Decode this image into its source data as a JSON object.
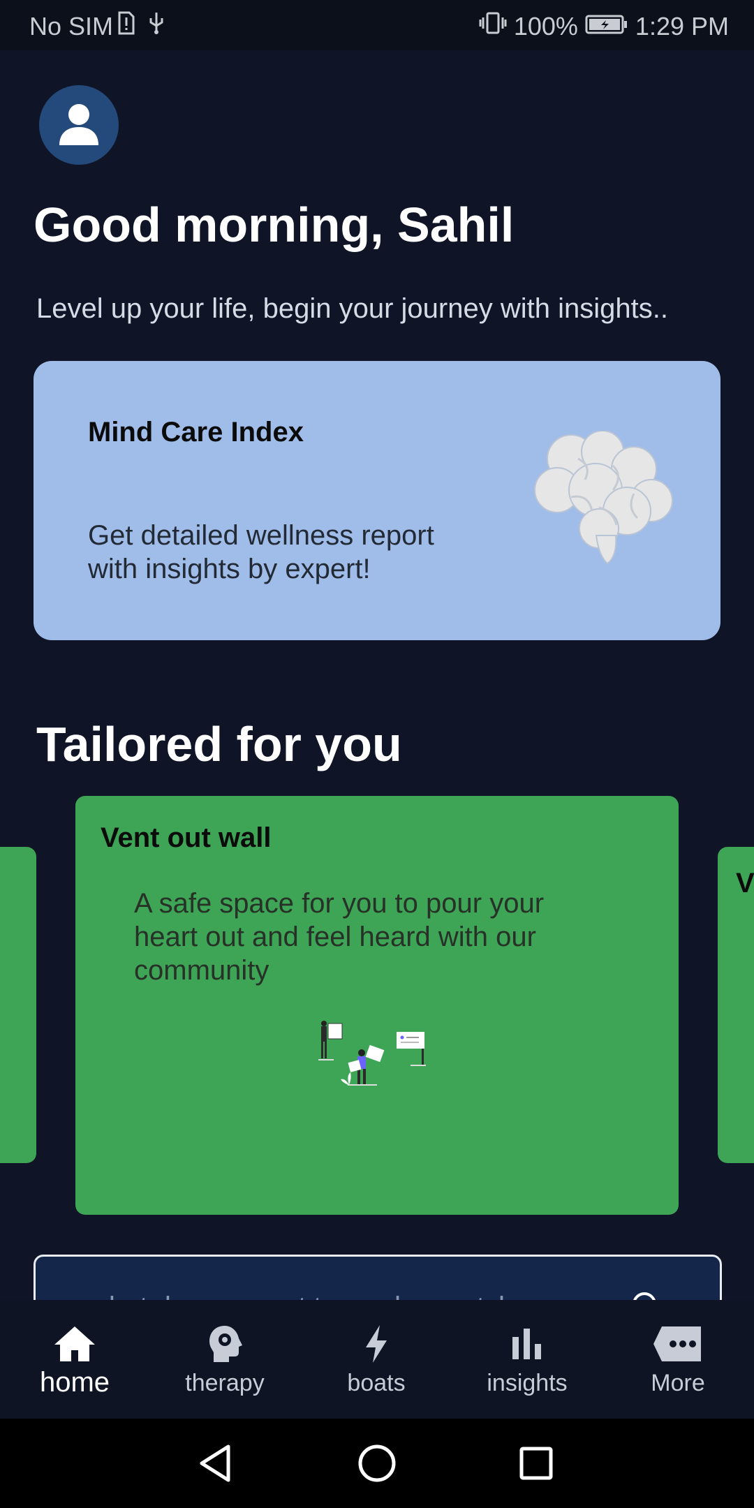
{
  "status_bar": {
    "carrier": "No SIM",
    "battery": "100%",
    "time": "1:29 PM"
  },
  "header": {
    "greeting": "Good morning, Sahil",
    "subtitle": "Level up your life, begin your journey with insights.."
  },
  "mind_care_card": {
    "title": "Mind Care Index",
    "description": "Get detailed wellness report with insights by expert!",
    "background_color": "#a0bde9",
    "icon": "brain-icon"
  },
  "tailored": {
    "section_title": "Tailored for you",
    "peek_right_initial": "V",
    "card": {
      "title": "Vent out wall",
      "description": "A safe space for you to pour your heart out and feel heard with our community",
      "background_color": "#3da555"
    }
  },
  "search": {
    "placeholder": "what do you want to read or watch"
  },
  "bottom_nav": {
    "items": [
      {
        "label": "home",
        "icon": "home-icon",
        "active": true
      },
      {
        "label": "therapy",
        "icon": "head-gear-icon",
        "active": false
      },
      {
        "label": "boats",
        "icon": "lightning-icon",
        "active": false
      },
      {
        "label": "insights",
        "icon": "bar-chart-icon",
        "active": false
      },
      {
        "label": "More",
        "icon": "more-chat-icon",
        "active": false
      }
    ]
  },
  "system_nav": [
    "back-icon",
    "home-circle-icon",
    "recents-icon"
  ]
}
